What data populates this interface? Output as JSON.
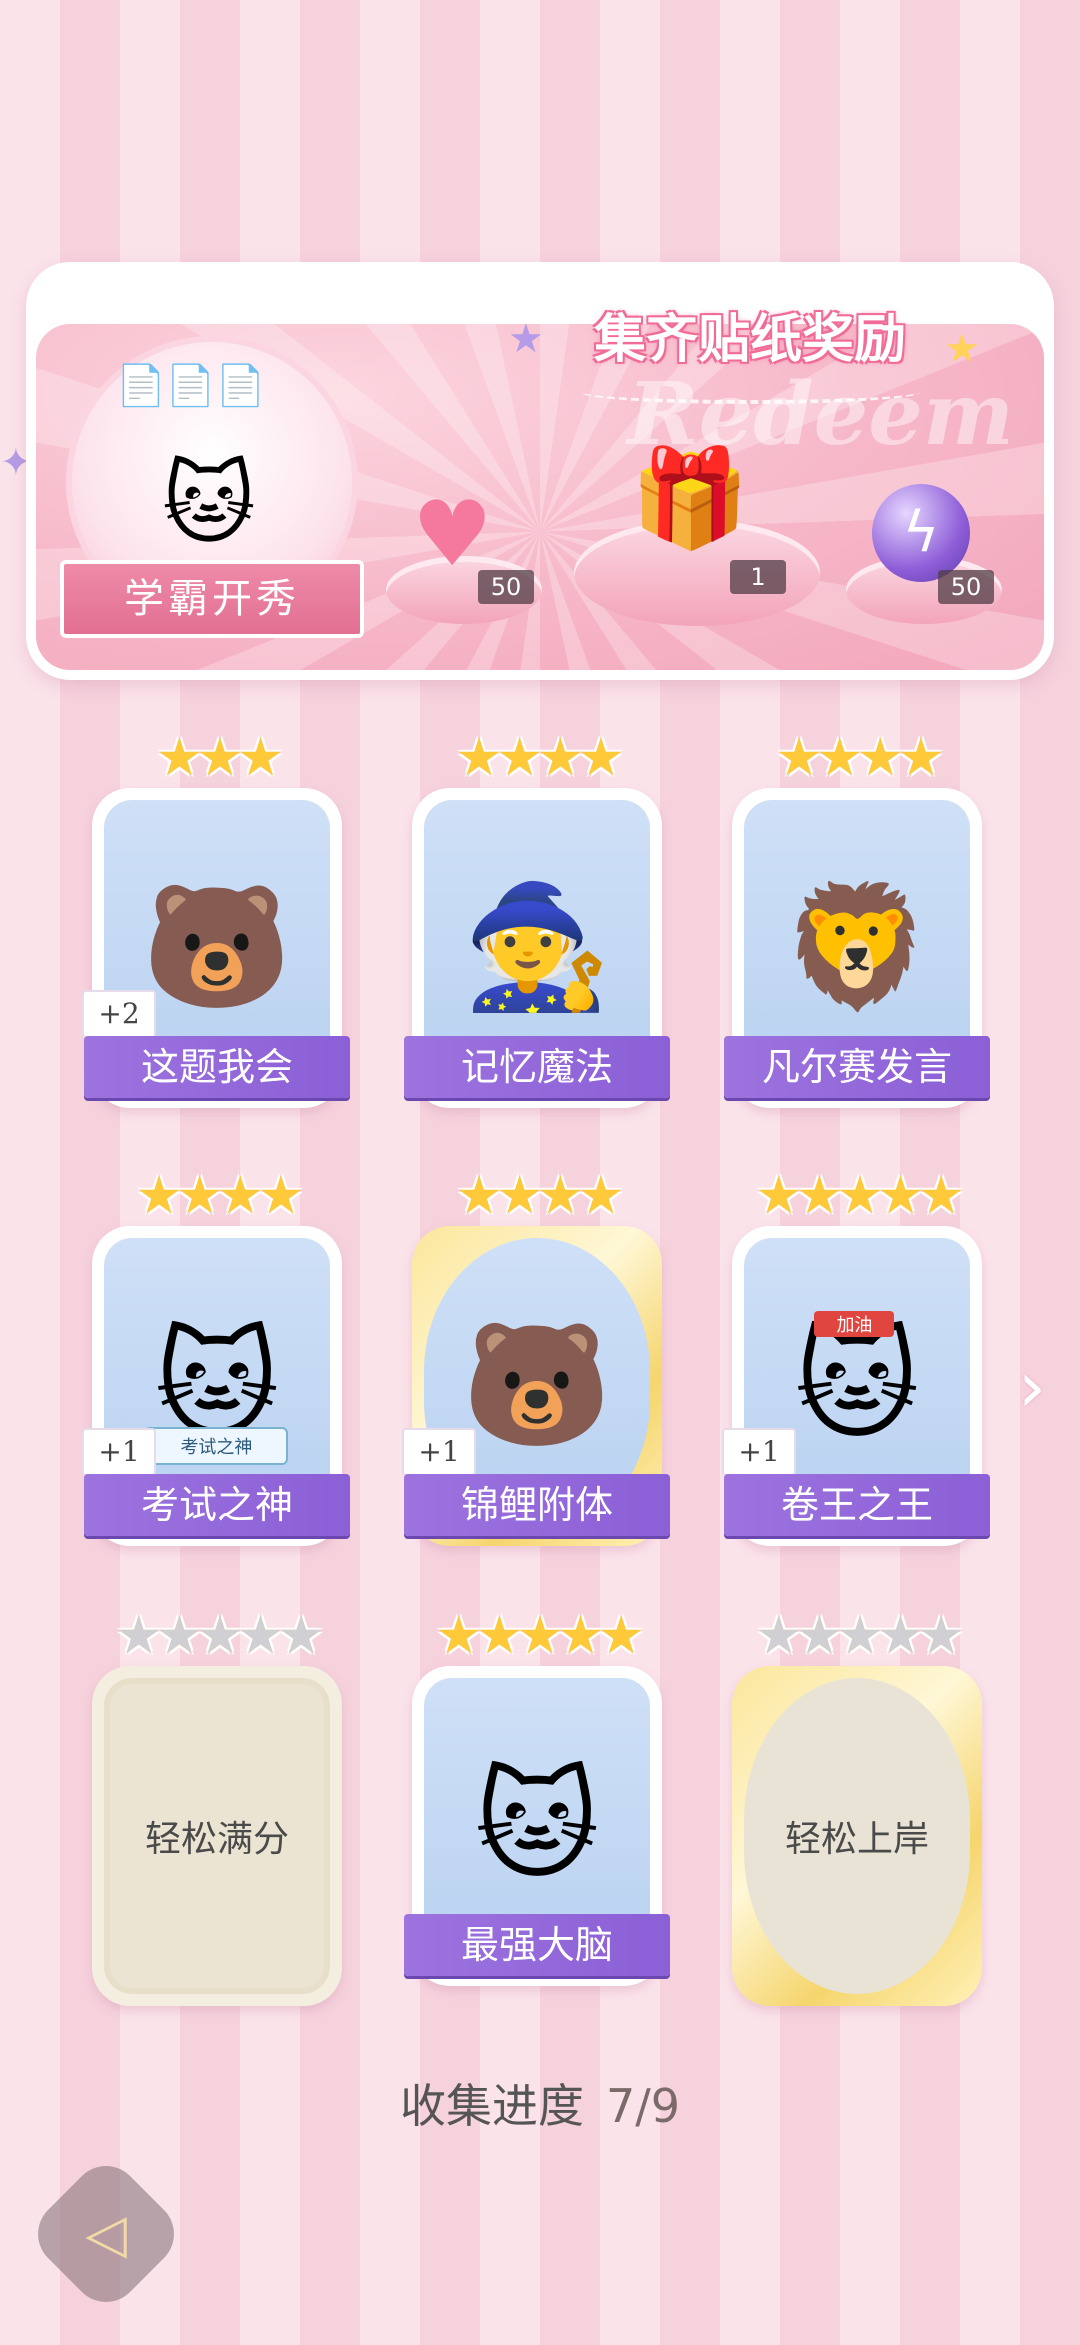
{
  "banner": {
    "title": "集齐贴纸奖励",
    "watermark": "Redeem",
    "badge_label": "学霸开秀",
    "rewards": [
      {
        "name": "pink-heart-gem",
        "count": "50"
      },
      {
        "name": "gift-box",
        "count": "1"
      },
      {
        "name": "purple-orb",
        "count": "50"
      }
    ]
  },
  "cards": [
    {
      "label": "这题我会",
      "stars": 3,
      "plus": "+2",
      "state": "collected",
      "icon": "bear-at-desk"
    },
    {
      "label": "记忆魔法",
      "stars": 4,
      "plus": "",
      "state": "collected",
      "icon": "otter-wizard"
    },
    {
      "label": "凡尔赛发言",
      "stars": 4,
      "plus": "",
      "state": "collected",
      "icon": "lion-microphone"
    },
    {
      "label": "考试之神",
      "stars": 4,
      "plus": "+1",
      "state": "collected",
      "icon": "angel-cat",
      "sign_text": "考试之神"
    },
    {
      "label": "锦鲤附体",
      "stars": 4,
      "plus": "+1",
      "state": "collected-gold",
      "icon": "bear-with-koi"
    },
    {
      "label": "卷王之王",
      "stars": 5,
      "plus": "+1",
      "state": "collected",
      "icon": "cat-studying",
      "headband_text": "加油"
    },
    {
      "label": "轻松满分",
      "stars": 5,
      "plus": "",
      "state": "locked",
      "icon": ""
    },
    {
      "label": "最强大脑",
      "stars": 5,
      "plus": "",
      "state": "collected",
      "icon": "cat-with-papers"
    },
    {
      "label": "轻松上岸",
      "stars": 5,
      "plus": "",
      "state": "locked-gold",
      "icon": ""
    }
  ],
  "progress": {
    "label": "收集进度",
    "value": "7/9"
  },
  "colors": {
    "accent_purple": "#8b5fd6",
    "pink": "#f3a6bb",
    "star_gold": "#ffc93a"
  }
}
